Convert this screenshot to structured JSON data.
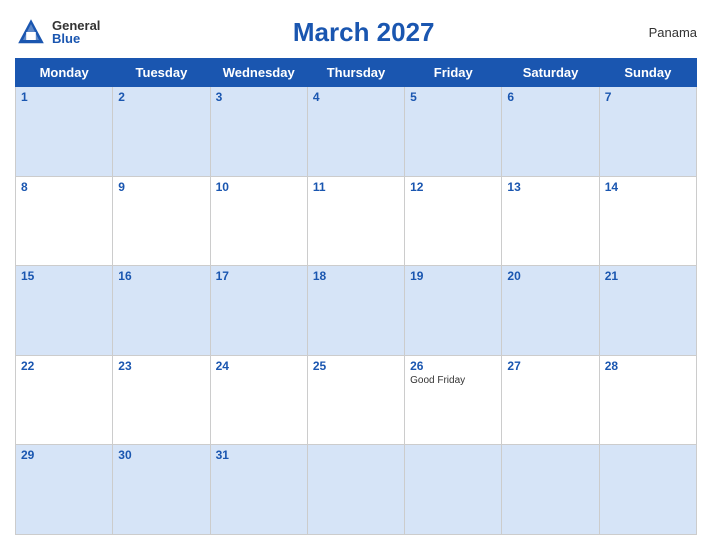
{
  "header": {
    "logo_general": "General",
    "logo_blue": "Blue",
    "title": "March 2027",
    "country": "Panama"
  },
  "weekdays": [
    "Monday",
    "Tuesday",
    "Wednesday",
    "Thursday",
    "Friday",
    "Saturday",
    "Sunday"
  ],
  "weeks": [
    [
      {
        "date": "1",
        "blue": true,
        "event": ""
      },
      {
        "date": "2",
        "blue": true,
        "event": ""
      },
      {
        "date": "3",
        "blue": true,
        "event": ""
      },
      {
        "date": "4",
        "blue": true,
        "event": ""
      },
      {
        "date": "5",
        "blue": true,
        "event": ""
      },
      {
        "date": "6",
        "blue": true,
        "event": ""
      },
      {
        "date": "7",
        "blue": true,
        "event": ""
      }
    ],
    [
      {
        "date": "8",
        "blue": false,
        "event": ""
      },
      {
        "date": "9",
        "blue": false,
        "event": ""
      },
      {
        "date": "10",
        "blue": false,
        "event": ""
      },
      {
        "date": "11",
        "blue": false,
        "event": ""
      },
      {
        "date": "12",
        "blue": false,
        "event": ""
      },
      {
        "date": "13",
        "blue": false,
        "event": ""
      },
      {
        "date": "14",
        "blue": false,
        "event": ""
      }
    ],
    [
      {
        "date": "15",
        "blue": true,
        "event": ""
      },
      {
        "date": "16",
        "blue": true,
        "event": ""
      },
      {
        "date": "17",
        "blue": true,
        "event": ""
      },
      {
        "date": "18",
        "blue": true,
        "event": ""
      },
      {
        "date": "19",
        "blue": true,
        "event": ""
      },
      {
        "date": "20",
        "blue": true,
        "event": ""
      },
      {
        "date": "21",
        "blue": true,
        "event": ""
      }
    ],
    [
      {
        "date": "22",
        "blue": false,
        "event": ""
      },
      {
        "date": "23",
        "blue": false,
        "event": ""
      },
      {
        "date": "24",
        "blue": false,
        "event": ""
      },
      {
        "date": "25",
        "blue": false,
        "event": ""
      },
      {
        "date": "26",
        "blue": false,
        "event": "Good Friday"
      },
      {
        "date": "27",
        "blue": false,
        "event": ""
      },
      {
        "date": "28",
        "blue": false,
        "event": ""
      }
    ],
    [
      {
        "date": "29",
        "blue": true,
        "event": ""
      },
      {
        "date": "30",
        "blue": true,
        "event": ""
      },
      {
        "date": "31",
        "blue": true,
        "event": ""
      },
      {
        "date": "",
        "blue": true,
        "event": ""
      },
      {
        "date": "",
        "blue": true,
        "event": ""
      },
      {
        "date": "",
        "blue": true,
        "event": ""
      },
      {
        "date": "",
        "blue": true,
        "event": ""
      }
    ]
  ]
}
